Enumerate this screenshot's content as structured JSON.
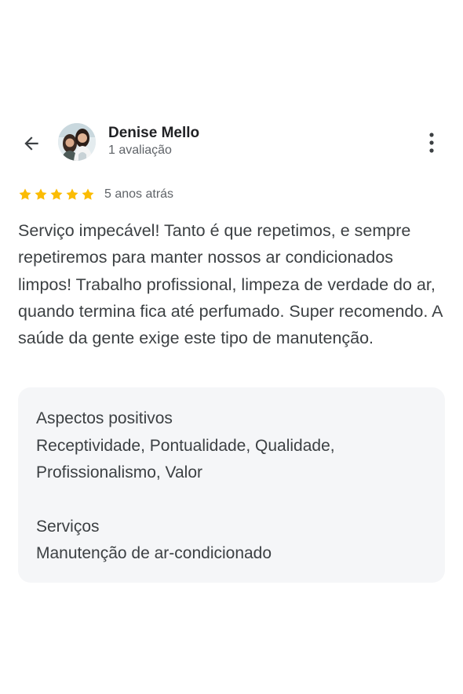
{
  "header": {
    "reviewer_name": "Denise Mello",
    "review_count": "1 avaliação",
    "back_icon": "arrow-back-icon",
    "more_icon": "more-vert-icon"
  },
  "rating": {
    "stars": 5,
    "max_stars": 5,
    "star_color": "#fbbc04",
    "time_ago": "5 anos atrás"
  },
  "review": {
    "text": "Serviço impecável! Tanto é que repetimos, e sempre repetiremos para manter nossos ar condicionados limpos! Trabalho profissional, limpeza de verdade do ar, quando termina fica até perfumado. Super recomendo. A saúde da gente exige este tipo de manutenção."
  },
  "details": {
    "positive_heading": "Aspectos positivos",
    "positive_value": "Receptividade, Pontualidade, Qualidade, Profissionalismo, Valor",
    "services_heading": "Serviços",
    "services_value": "Manutenção de ar-condicionado"
  }
}
